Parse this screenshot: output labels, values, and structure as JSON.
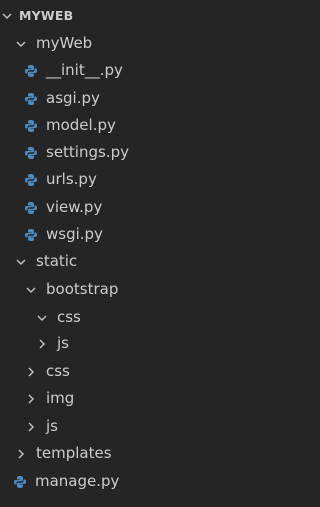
{
  "explorer": {
    "root": {
      "label": "MYWEB",
      "expanded": true
    },
    "items": [
      {
        "label": "myWeb",
        "kind": "folder",
        "expanded": true,
        "depth": 1
      },
      {
        "label": "__init__.py",
        "kind": "file",
        "icon": "python-icon",
        "depth": 2
      },
      {
        "label": "asgi.py",
        "kind": "file",
        "icon": "python-icon",
        "depth": 2
      },
      {
        "label": "model.py",
        "kind": "file",
        "icon": "python-icon",
        "depth": 2
      },
      {
        "label": "settings.py",
        "kind": "file",
        "icon": "python-icon",
        "depth": 2
      },
      {
        "label": "urls.py",
        "kind": "file",
        "icon": "python-icon",
        "depth": 2
      },
      {
        "label": "view.py",
        "kind": "file",
        "icon": "python-icon",
        "depth": 2
      },
      {
        "label": "wsgi.py",
        "kind": "file",
        "icon": "python-icon",
        "depth": 2
      },
      {
        "label": "static",
        "kind": "folder",
        "expanded": true,
        "depth": 1
      },
      {
        "label": "bootstrap",
        "kind": "folder",
        "expanded": true,
        "depth": 2
      },
      {
        "label": "css",
        "kind": "folder",
        "expanded": true,
        "depth": 3
      },
      {
        "label": "js",
        "kind": "folder",
        "expanded": false,
        "depth": 3
      },
      {
        "label": "css",
        "kind": "folder",
        "expanded": false,
        "depth": 2
      },
      {
        "label": "img",
        "kind": "folder",
        "expanded": false,
        "depth": 2
      },
      {
        "label": "js",
        "kind": "folder",
        "expanded": false,
        "depth": 2
      },
      {
        "label": "templates",
        "kind": "folder",
        "expanded": false,
        "depth": 1
      },
      {
        "label": "manage.py",
        "kind": "file",
        "icon": "python-icon",
        "depth": 1
      }
    ]
  },
  "colors": {
    "background": "#252526",
    "text": "#cccccc",
    "python_blue": "#4a8bc2",
    "python_yellow": "#f2c94c",
    "chevron": "#c5c5c5"
  }
}
